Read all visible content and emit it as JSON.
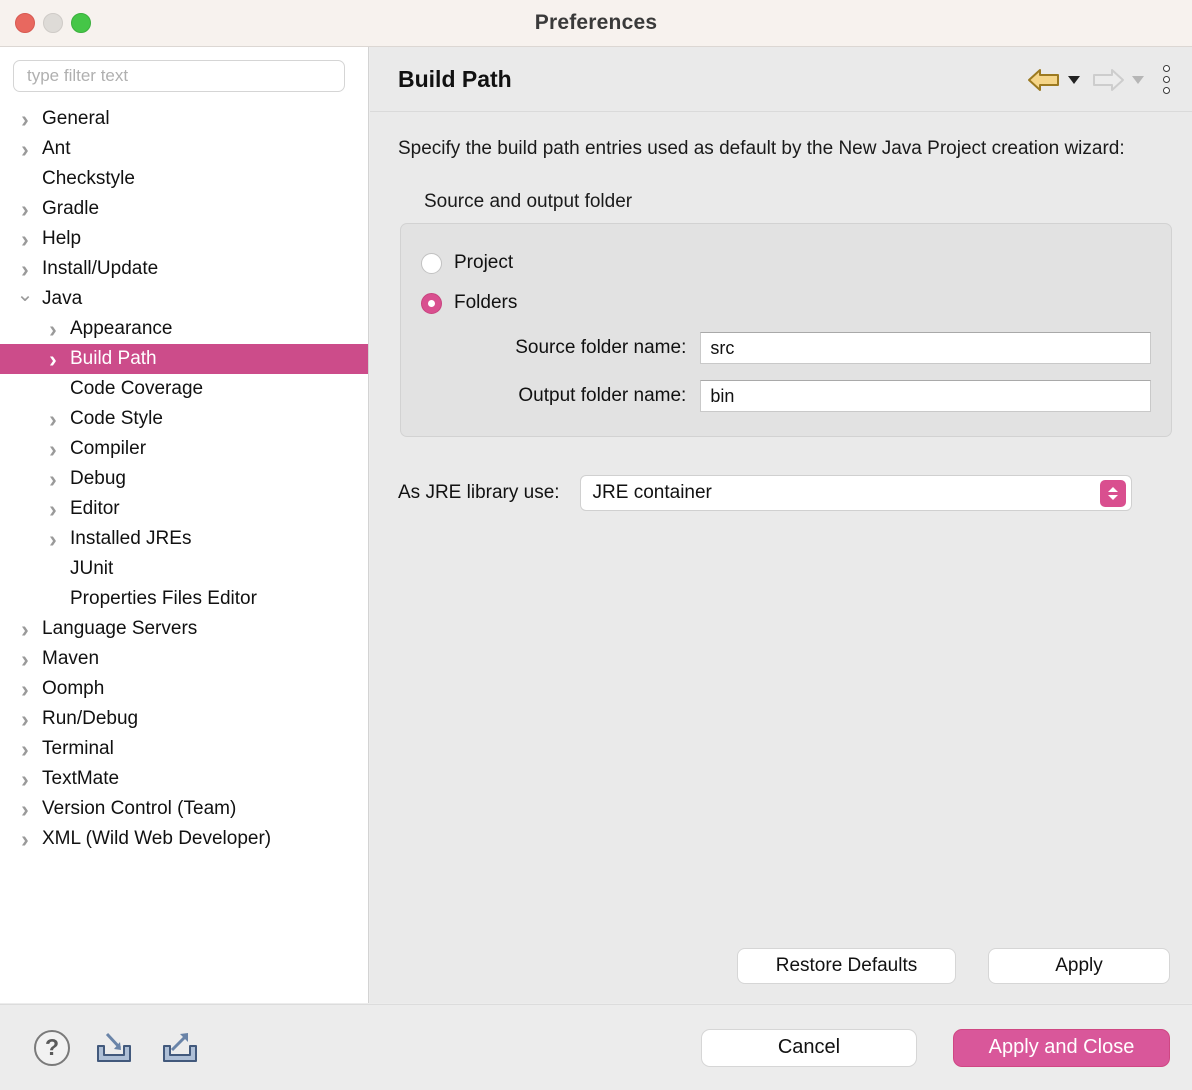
{
  "window": {
    "title": "Preferences",
    "traffic_lights": [
      "close",
      "minimize",
      "zoom"
    ]
  },
  "sidebar": {
    "filter_placeholder": "type filter text",
    "filter_value": "",
    "items": [
      {
        "label": "General",
        "level": 0,
        "twisty": "closed",
        "selected": false
      },
      {
        "label": "Ant",
        "level": 0,
        "twisty": "closed",
        "selected": false
      },
      {
        "label": "Checkstyle",
        "level": 0,
        "twisty": "none",
        "selected": false
      },
      {
        "label": "Gradle",
        "level": 0,
        "twisty": "closed",
        "selected": false
      },
      {
        "label": "Help",
        "level": 0,
        "twisty": "closed",
        "selected": false
      },
      {
        "label": "Install/Update",
        "level": 0,
        "twisty": "closed",
        "selected": false
      },
      {
        "label": "Java",
        "level": 0,
        "twisty": "open",
        "selected": false
      },
      {
        "label": "Appearance",
        "level": 1,
        "twisty": "closed",
        "selected": false
      },
      {
        "label": "Build Path",
        "level": 1,
        "twisty": "closed",
        "selected": true
      },
      {
        "label": "Code Coverage",
        "level": 1,
        "twisty": "none",
        "selected": false
      },
      {
        "label": "Code Style",
        "level": 1,
        "twisty": "closed",
        "selected": false
      },
      {
        "label": "Compiler",
        "level": 1,
        "twisty": "closed",
        "selected": false
      },
      {
        "label": "Debug",
        "level": 1,
        "twisty": "closed",
        "selected": false
      },
      {
        "label": "Editor",
        "level": 1,
        "twisty": "closed",
        "selected": false
      },
      {
        "label": "Installed JREs",
        "level": 1,
        "twisty": "closed",
        "selected": false
      },
      {
        "label": "JUnit",
        "level": 1,
        "twisty": "none",
        "selected": false
      },
      {
        "label": "Properties Files Editor",
        "level": 1,
        "twisty": "none",
        "selected": false
      },
      {
        "label": "Language Servers",
        "level": 0,
        "twisty": "closed",
        "selected": false
      },
      {
        "label": "Maven",
        "level": 0,
        "twisty": "closed",
        "selected": false
      },
      {
        "label": "Oomph",
        "level": 0,
        "twisty": "closed",
        "selected": false
      },
      {
        "label": "Run/Debug",
        "level": 0,
        "twisty": "closed",
        "selected": false
      },
      {
        "label": "Terminal",
        "level": 0,
        "twisty": "closed",
        "selected": false
      },
      {
        "label": "TextMate",
        "level": 0,
        "twisty": "closed",
        "selected": false
      },
      {
        "label": "Version Control (Team)",
        "level": 0,
        "twisty": "closed",
        "selected": false
      },
      {
        "label": "XML (Wild Web Developer)",
        "level": 0,
        "twisty": "closed",
        "selected": false
      }
    ]
  },
  "panel": {
    "title": "Build Path",
    "toolbar": {
      "back_icon": "back-arrow-icon",
      "back_dropdown_icon": "chevron-down-icon",
      "forward_icon": "forward-arrow-icon",
      "forward_dropdown_icon": "chevron-down-icon",
      "menu_icon": "vertical-dots-icon"
    },
    "description": "Specify the build path entries used as default by the New Java Project creation wizard:",
    "group": {
      "label": "Source and output folder",
      "radio_project": "Project",
      "radio_folders": "Folders",
      "selected_radio": "Folders",
      "source_label": "Source folder name:",
      "source_value": "src",
      "output_label": "Output folder name:",
      "output_value": "bin"
    },
    "jre": {
      "label": "As JRE library use:",
      "value": "JRE container",
      "stepper_icon": "up-down-stepper-icon"
    },
    "buttons": {
      "restore_defaults": "Restore Defaults",
      "apply": "Apply"
    }
  },
  "footer": {
    "help_icon": "question-mark-icon",
    "help_glyph": "?",
    "import_icon": "import-preferences-icon",
    "export_icon": "export-preferences-icon",
    "cancel": "Cancel",
    "apply_and_close": "Apply and Close"
  },
  "colors": {
    "accent_pink": "#cc4c8a",
    "accent_pink_button": "#d9579a",
    "radio_pink": "#d94f8f",
    "panel_bg": "#eaeaea",
    "sidebar_bg": "#ffffff",
    "titlebar_bg": "#f7f2ee",
    "back_arrow_gold": "#f0c96a"
  }
}
